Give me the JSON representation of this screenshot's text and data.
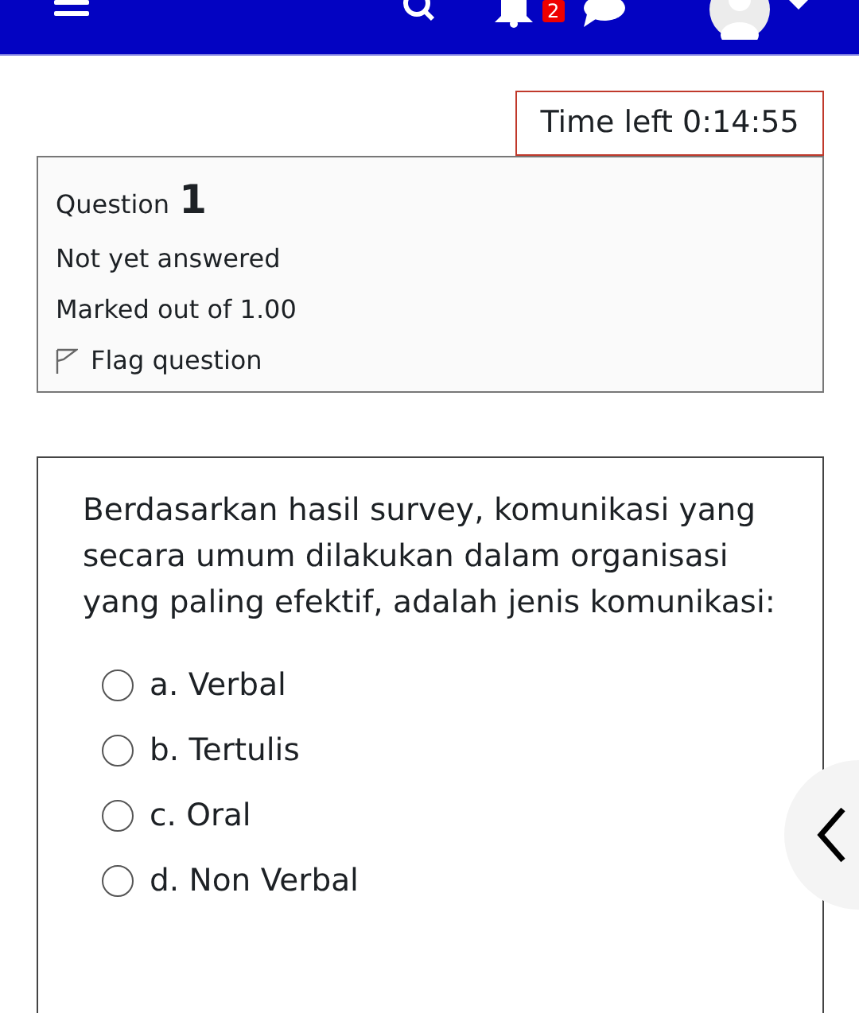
{
  "navbar": {
    "notification_count": "2"
  },
  "timer": {
    "label": "Time left",
    "value": "0:14:55"
  },
  "question_info": {
    "label": "Question",
    "number": "1",
    "status": "Not yet answered",
    "marks": "Marked out of 1.00",
    "flag": {
      "label": "Flag question",
      "flagged": false
    }
  },
  "question": {
    "text": "Berdasarkan hasil survey, komunikasi yang secara umum dilakukan dalam organisasi yang paling efektif, adalah jenis komunikasi:",
    "options": [
      {
        "label": "a. Verbal",
        "selected": false
      },
      {
        "label": "b. Tertulis",
        "selected": false
      },
      {
        "label": "c. Oral",
        "selected": false
      },
      {
        "label": "d. Non Verbal",
        "selected": false
      }
    ]
  }
}
